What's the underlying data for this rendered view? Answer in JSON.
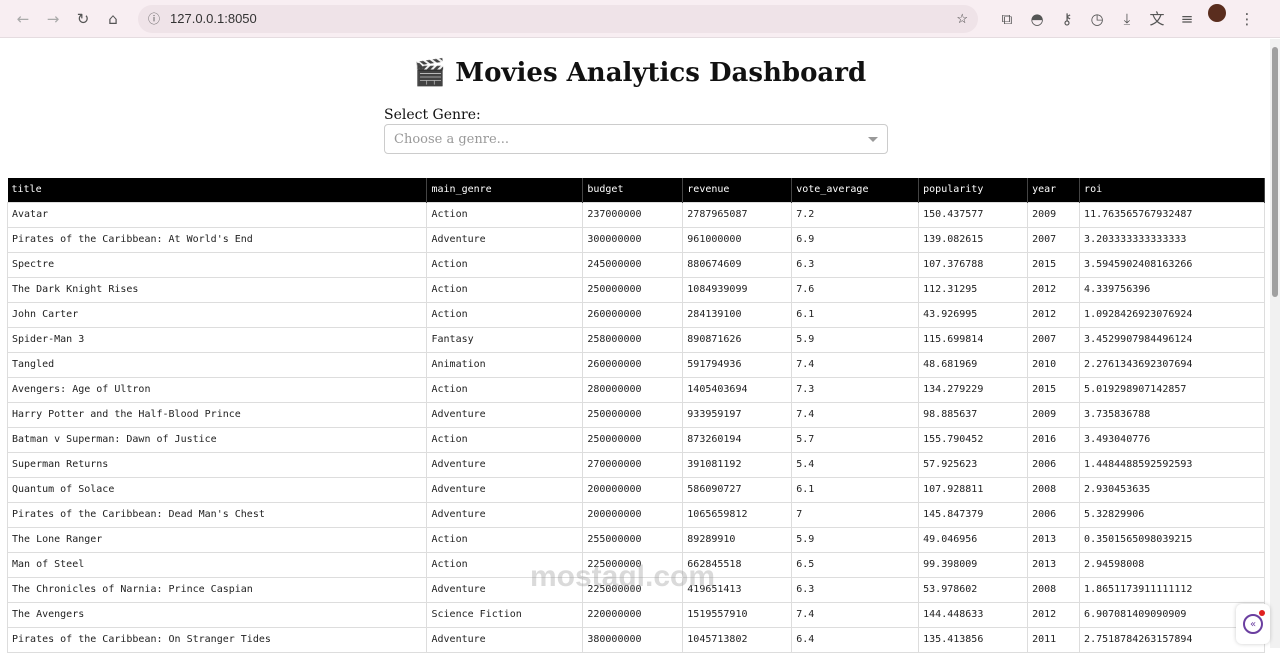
{
  "browser": {
    "url": "127.0.0.1:8050"
  },
  "header": {
    "icon": "🎬",
    "title": "Movies Analytics Dashboard"
  },
  "filter": {
    "label": "Select Genre:",
    "placeholder": "Choose a genre..."
  },
  "table": {
    "columns": [
      "title",
      "main_genre",
      "budget",
      "revenue",
      "vote_average",
      "popularity",
      "year",
      "roi"
    ],
    "rows": [
      [
        "Avatar",
        "Action",
        "237000000",
        "2787965087",
        "7.2",
        "150.437577",
        "2009",
        "11.763565767932487"
      ],
      [
        "Pirates of the Caribbean: At World's End",
        "Adventure",
        "300000000",
        "961000000",
        "6.9",
        "139.082615",
        "2007",
        "3.203333333333333"
      ],
      [
        "Spectre",
        "Action",
        "245000000",
        "880674609",
        "6.3",
        "107.376788",
        "2015",
        "3.5945902408163266"
      ],
      [
        "The Dark Knight Rises",
        "Action",
        "250000000",
        "1084939099",
        "7.6",
        "112.31295",
        "2012",
        "4.339756396"
      ],
      [
        "John Carter",
        "Action",
        "260000000",
        "284139100",
        "6.1",
        "43.926995",
        "2012",
        "1.0928426923076924"
      ],
      [
        "Spider-Man 3",
        "Fantasy",
        "258000000",
        "890871626",
        "5.9",
        "115.699814",
        "2007",
        "3.4529907984496124"
      ],
      [
        "Tangled",
        "Animation",
        "260000000",
        "591794936",
        "7.4",
        "48.681969",
        "2010",
        "2.2761343692307694"
      ],
      [
        "Avengers: Age of Ultron",
        "Action",
        "280000000",
        "1405403694",
        "7.3",
        "134.279229",
        "2015",
        "5.019298907142857"
      ],
      [
        "Harry Potter and the Half-Blood Prince",
        "Adventure",
        "250000000",
        "933959197",
        "7.4",
        "98.885637",
        "2009",
        "3.735836788"
      ],
      [
        "Batman v Superman: Dawn of Justice",
        "Action",
        "250000000",
        "873260194",
        "5.7",
        "155.790452",
        "2016",
        "3.493040776"
      ],
      [
        "Superman Returns",
        "Adventure",
        "270000000",
        "391081192",
        "5.4",
        "57.925623",
        "2006",
        "1.4484488592592593"
      ],
      [
        "Quantum of Solace",
        "Adventure",
        "200000000",
        "586090727",
        "6.1",
        "107.928811",
        "2008",
        "2.930453635"
      ],
      [
        "Pirates of the Caribbean: Dead Man's Chest",
        "Adventure",
        "200000000",
        "1065659812",
        "7",
        "145.847379",
        "2006",
        "5.32829906"
      ],
      [
        "The Lone Ranger",
        "Action",
        "255000000",
        "89289910",
        "5.9",
        "49.046956",
        "2013",
        "0.3501565098039215"
      ],
      [
        "Man of Steel",
        "Action",
        "225000000",
        "662845518",
        "6.5",
        "99.398009",
        "2013",
        "2.94598008"
      ],
      [
        "The Chronicles of Narnia: Prince Caspian",
        "Adventure",
        "225000000",
        "419651413",
        "6.3",
        "53.978602",
        "2008",
        "1.8651173911111112"
      ],
      [
        "The Avengers",
        "Science Fiction",
        "220000000",
        "1519557910",
        "7.4",
        "144.448633",
        "2012",
        "6.907081409090909"
      ],
      [
        "Pirates of the Caribbean: On Stranger Tides",
        "Adventure",
        "380000000",
        "1045713802",
        "6.4",
        "135.413856",
        "2011",
        "2.7518784263157894"
      ]
    ]
  },
  "watermark": "mostaql.com"
}
